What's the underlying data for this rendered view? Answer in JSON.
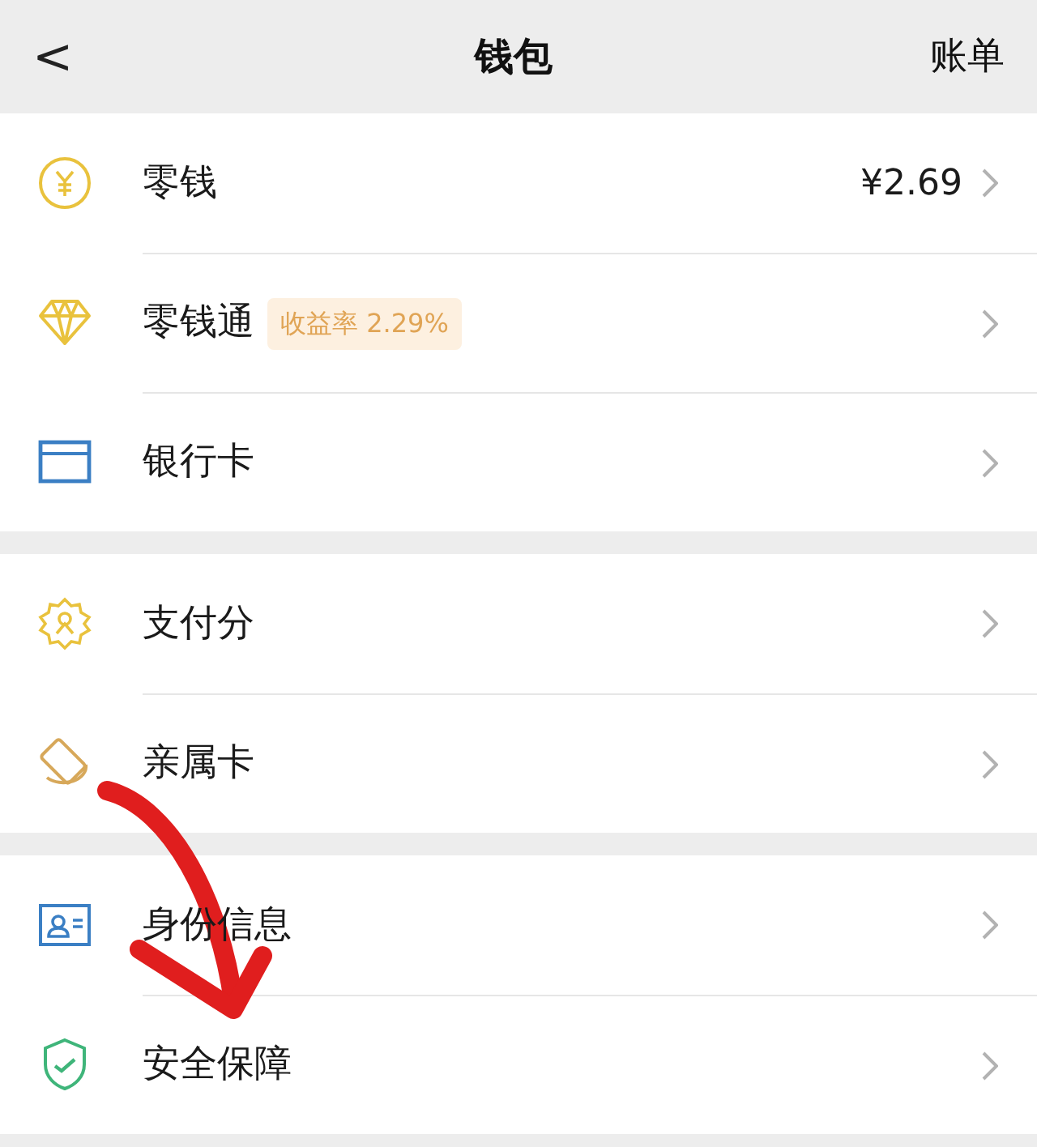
{
  "header": {
    "back": "<",
    "title": "钱包",
    "action": "账单"
  },
  "groups": [
    {
      "items": [
        {
          "label": "零钱",
          "value": "¥2.69"
        },
        {
          "label": "零钱通",
          "badge": "收益率 2.29%"
        },
        {
          "label": "银行卡"
        }
      ]
    },
    {
      "items": [
        {
          "label": "支付分"
        },
        {
          "label": "亲属卡"
        }
      ]
    },
    {
      "items": [
        {
          "label": "身份信息"
        },
        {
          "label": "安全保障"
        }
      ]
    }
  ]
}
